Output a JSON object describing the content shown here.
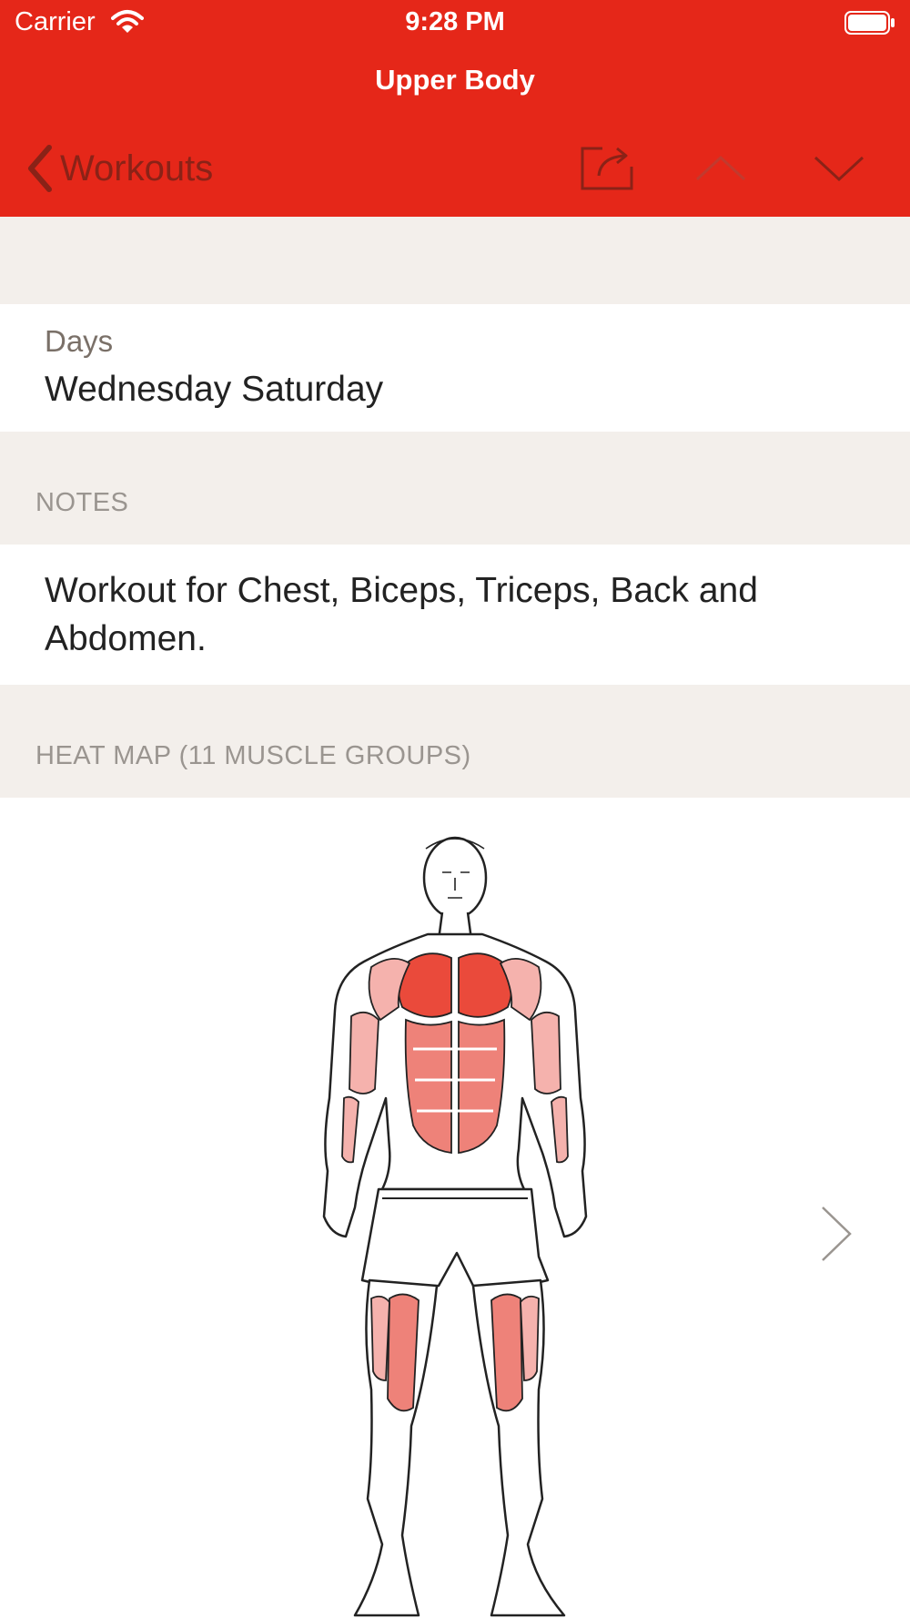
{
  "status_bar": {
    "carrier": "Carrier",
    "time": "9:28 PM"
  },
  "nav": {
    "title": "Upper Body",
    "back_label": "Workouts"
  },
  "days": {
    "label": "Days",
    "value": "Wednesday Saturday"
  },
  "notes": {
    "header": "NOTES",
    "text": "Workout for Chest, Biceps, Triceps, Back and Abdomen."
  },
  "heat_map": {
    "header": "HEAT MAP (11 MUSCLE GROUPS)"
  },
  "colors": {
    "accent": "#e52719",
    "muscle_high": "#ea4a3b",
    "muscle_mid": "#ee8279",
    "muscle_low": "#f5b2ad"
  }
}
